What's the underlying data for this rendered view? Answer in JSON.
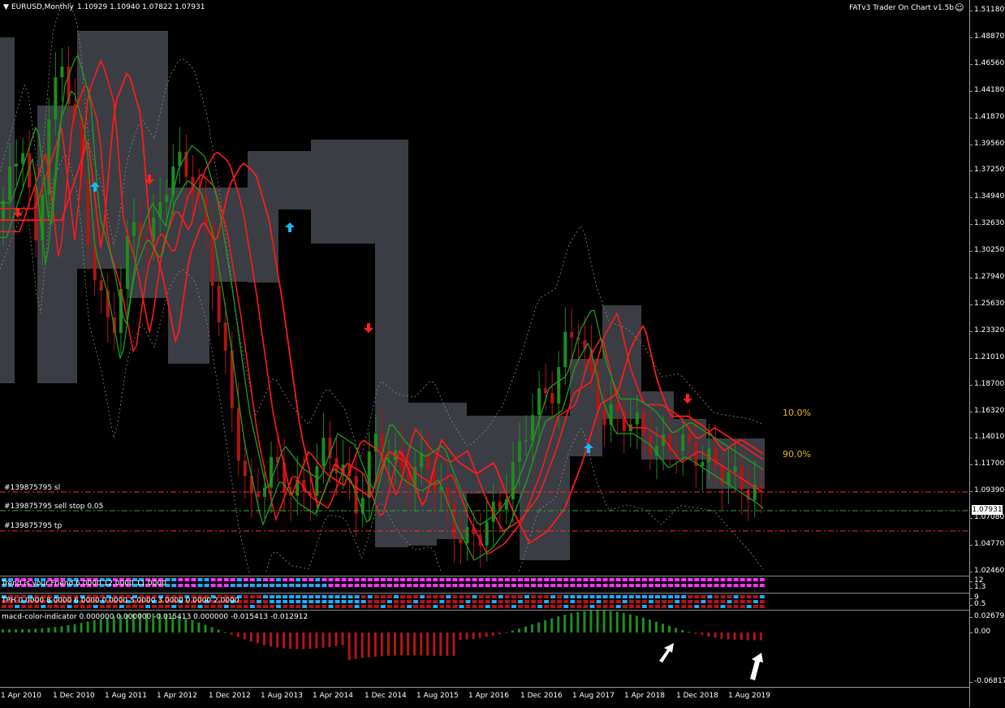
{
  "header": {
    "symbol": "EURUSD,Monthly",
    "ohlc": "1.10929 1.10940 1.07822 1.07931",
    "indicator_title": "FATv3 Trader On Chart v1.5b"
  },
  "orders": {
    "sl_label": "#139875795 sl",
    "entry_label": "#139875795 sell stop 0.05",
    "tp_label": "#139875795 tp"
  },
  "fib_levels": {
    "upper": "10.0%",
    "lower": "90.0%"
  },
  "price_axis": {
    "ticks": [
      "1.51180",
      "1.48870",
      "1.46560",
      "1.44180",
      "1.41870",
      "1.39560",
      "1.37250",
      "1.34940",
      "1.32630",
      "1.30250",
      "1.27940",
      "1.25630",
      "1.23320",
      "1.21010",
      "1.18700",
      "1.16320",
      "1.14010",
      "1.11700",
      "1.09390",
      "1.07080",
      "1.04770",
      "1.02460"
    ],
    "current_price": "1.07931"
  },
  "subpanes": {
    "trend_label": "Trend is your Friend 6.0000 12.0000 11.0000",
    "trend_scale_top": "12",
    "trend_scale_bottom": "1.3",
    "tph_label": "TPH 0.0000 8.0000 6.0000 0.0000 5.0000 3.0000 0.0000 2.0000",
    "tph_scale_top": "9",
    "tph_scale_bottom": "0.5",
    "macd_label": "macd-color-indicator 0.000000 0.000000 -0.015413 0.000000 -0.015413 -0.012912",
    "macd_ticks": [
      "0.026795",
      "0.00",
      "-0.06817"
    ]
  },
  "time_axis": [
    "1 Apr 2010",
    "1 Dec 2010",
    "1 Aug 2011",
    "1 Apr 2012",
    "1 Dec 2012",
    "1 Aug 2013",
    "1 Apr 2014",
    "1 Dec 2014",
    "1 Aug 2015",
    "1 Apr 2016",
    "1 Dec 2016",
    "1 Aug 2017",
    "1 Apr 2018",
    "1 Dec 2018",
    "1 Aug 2019"
  ],
  "colors": {
    "background": "#000000",
    "bull": "#1e8c1e",
    "bear": "#b41414",
    "ma_red": "#ff1a1a",
    "ma_green": "#1f9e1f",
    "box": "#3a3d44",
    "sl_tp_line": "#ff2a2a",
    "entry_line": "#2ea82e",
    "fib_text": "#e6b800",
    "magenta": "#ff33ff",
    "cyan": "#22aaff",
    "arrow_up": "#19b6ff",
    "arrow_down": "#ff2020"
  }
}
